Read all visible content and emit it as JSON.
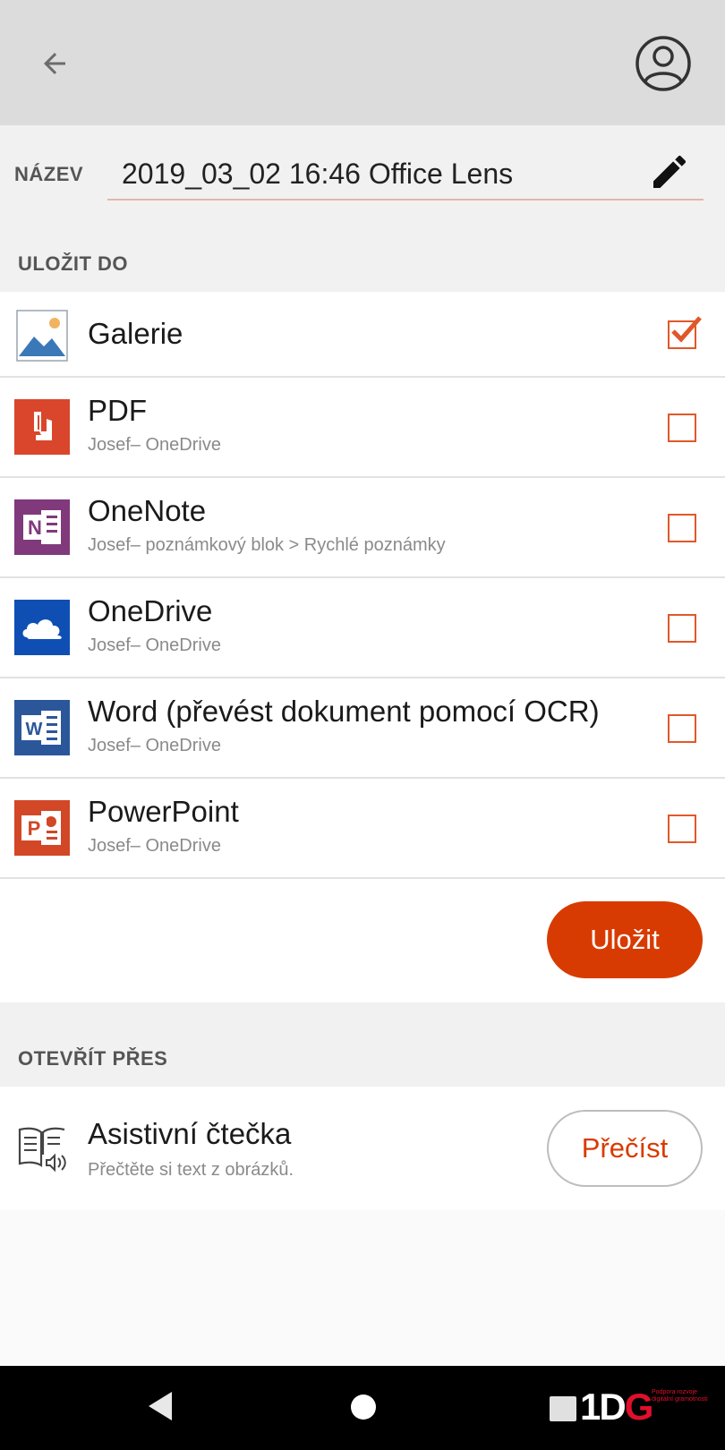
{
  "header": {
    "back_icon": "arrow-left-icon",
    "profile_icon": "account-circle-icon"
  },
  "name": {
    "label": "NÁZEV",
    "value": "2019_03_02 16:46 Office Lens",
    "edit_icon": "pencil-icon"
  },
  "save_to": {
    "heading": "ULOŽIT DO",
    "items": [
      {
        "title": "Galerie",
        "subtitle": "",
        "icon": "gallery-icon",
        "checked": true
      },
      {
        "title": "PDF",
        "subtitle": "Josef– OneDrive",
        "icon": "pdf-icon",
        "checked": false
      },
      {
        "title": "OneNote",
        "subtitle": "Josef– poznámkový blok > Rychlé poznámky",
        "icon": "onenote-icon",
        "checked": false
      },
      {
        "title": "OneDrive",
        "subtitle": "Josef– OneDrive",
        "icon": "onedrive-icon",
        "checked": false
      },
      {
        "title": "Word (převést dokument pomocí OCR)",
        "subtitle": "Josef– OneDrive",
        "icon": "word-icon",
        "checked": false
      },
      {
        "title": "PowerPoint",
        "subtitle": "Josef– OneDrive",
        "icon": "powerpoint-icon",
        "checked": false
      }
    ],
    "save_label": "Uložit"
  },
  "open_with": {
    "heading": "OTEVŘÍT PŘES",
    "reader_title": "Asistivní čtečka",
    "reader_sub": "Přečtěte si text z obrázků.",
    "read_label": "Přečíst",
    "reader_icon": "immersive-reader-icon"
  },
  "navbar": {
    "brand": "1DG",
    "brand_text": "Podpora rozvoje digitální gramotnosti"
  },
  "colors": {
    "accent": "#d83b01",
    "checkbox": "#e0582a",
    "pdf": "#d9462c",
    "onenote": "#80397b",
    "onedrive": "#0f4fb4",
    "word": "#2b579a",
    "powerpoint": "#d24726"
  }
}
